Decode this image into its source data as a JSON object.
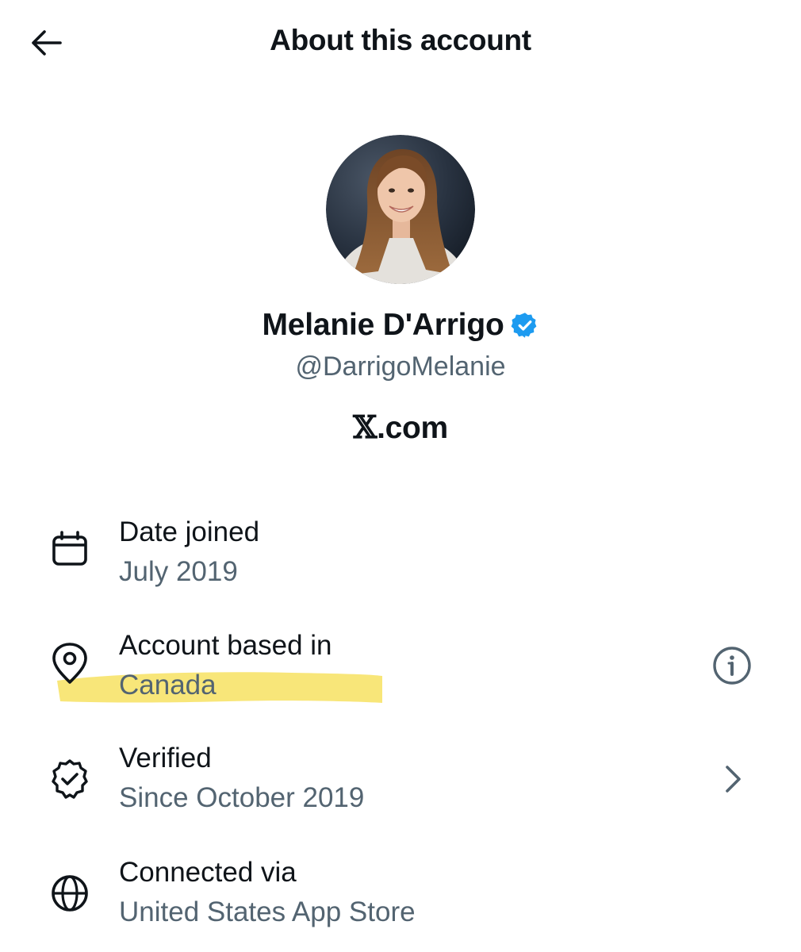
{
  "header": {
    "title": "About this account",
    "back_icon": "arrow-left-icon"
  },
  "profile": {
    "display_name": "Melanie D'Arrigo",
    "handle": "@DarrigoMelanie",
    "verified": true,
    "verified_badge_color": "#1d9bf0",
    "source_prefix": "𝕏",
    "source_suffix": ".com"
  },
  "details": [
    {
      "icon": "calendar-icon",
      "title": "Date joined",
      "value": "July 2019"
    },
    {
      "icon": "location-pin-icon",
      "title": "Account based in",
      "value": "Canada",
      "highlighted": true,
      "trailing_icon": "info-icon"
    },
    {
      "icon": "verified-check-icon",
      "title": "Verified",
      "value": "Since October 2019",
      "trailing_icon": "chevron-right-icon"
    },
    {
      "icon": "globe-icon",
      "title": "Connected via",
      "value": "United States App Store"
    }
  ],
  "colors": {
    "primary_text": "#0f1419",
    "secondary_text": "#536471",
    "highlight": "#f7e36a",
    "background": "#ffffff"
  }
}
